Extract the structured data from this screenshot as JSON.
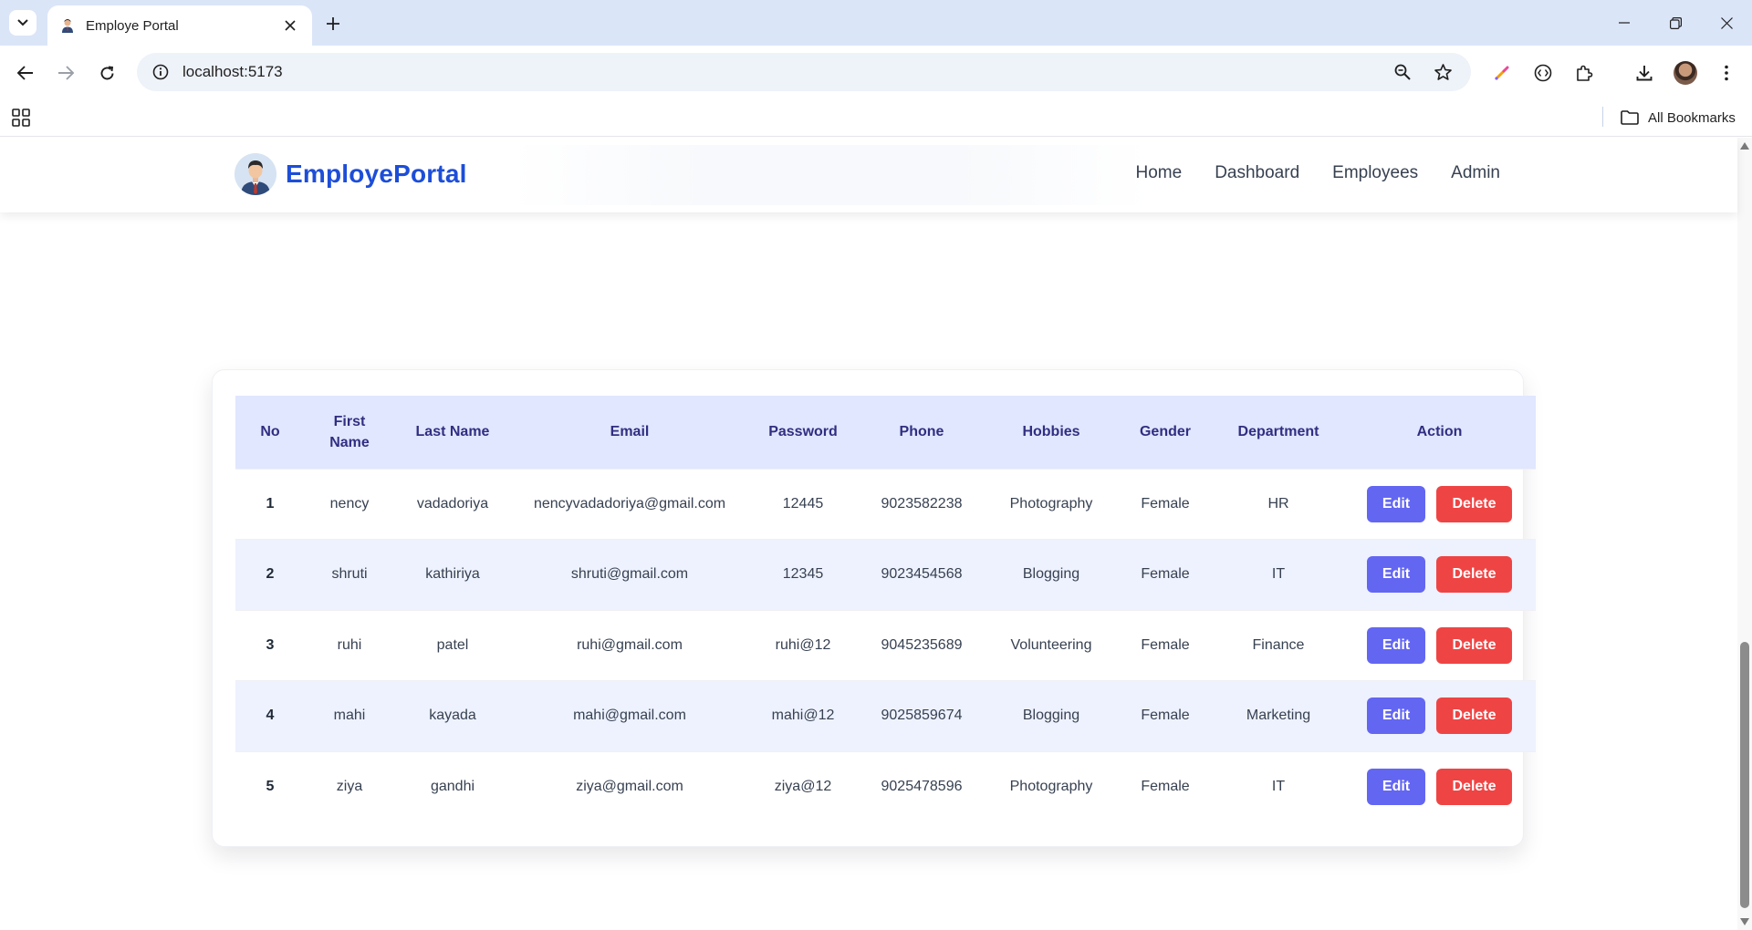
{
  "browser": {
    "tab_title": "Employe Portal",
    "url": "localhost:5173",
    "bookmarks_label": "All Bookmarks"
  },
  "site": {
    "brand": "EmployePortal",
    "nav": [
      "Home",
      "Dashboard",
      "Employees",
      "Admin"
    ]
  },
  "table": {
    "headers": [
      "No",
      "First Name",
      "Last Name",
      "Email",
      "Password",
      "Phone",
      "Hobbies",
      "Gender",
      "Department",
      "Action"
    ],
    "rows": [
      {
        "no": "1",
        "first": "nency",
        "last": "vadadoriya",
        "email": "nencyvadadoriya@gmail.com",
        "password": "12445",
        "phone": "9023582238",
        "hobbies": "Photography",
        "gender": "Female",
        "department": "HR"
      },
      {
        "no": "2",
        "first": "shruti",
        "last": "kathiriya",
        "email": "shruti@gmail.com",
        "password": "12345",
        "phone": "9023454568",
        "hobbies": "Blogging",
        "gender": "Female",
        "department": "IT"
      },
      {
        "no": "3",
        "first": "ruhi",
        "last": "patel",
        "email": "ruhi@gmail.com",
        "password": "ruhi@12",
        "phone": "9045235689",
        "hobbies": "Volunteering",
        "gender": "Female",
        "department": "Finance"
      },
      {
        "no": "4",
        "first": "mahi",
        "last": "kayada",
        "email": "mahi@gmail.com",
        "password": "mahi@12",
        "phone": "9025859674",
        "hobbies": "Blogging",
        "gender": "Female",
        "department": "Marketing"
      },
      {
        "no": "5",
        "first": "ziya",
        "last": "gandhi",
        "email": "ziya@gmail.com",
        "password": "ziya@12",
        "phone": "9025478596",
        "hobbies": "Photography",
        "gender": "Female",
        "department": "IT"
      }
    ],
    "edit_label": "Edit",
    "delete_label": "Delete"
  },
  "colors": {
    "brand": "#1d4ed8",
    "header_bg": "#e0e7ff",
    "edit": "#6366f1",
    "delete": "#ef4444"
  }
}
